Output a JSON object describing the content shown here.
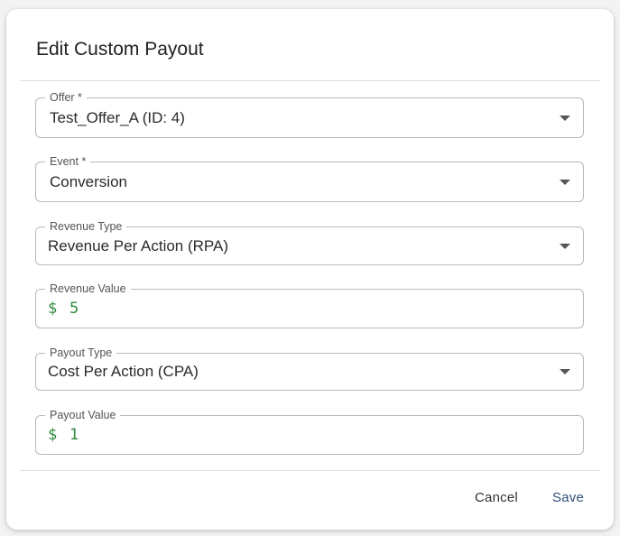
{
  "dialog": {
    "title": "Edit Custom Payout"
  },
  "fields": {
    "offer": {
      "label": "Offer *",
      "value": "Test_Offer_A (ID: 4)"
    },
    "event": {
      "label": "Event *",
      "value": "Conversion"
    },
    "revenue_type": {
      "label": "Revenue Type",
      "value": "Revenue Per Action (RPA)"
    },
    "revenue_value": {
      "label": "Revenue Value",
      "currency": "$",
      "value": "5"
    },
    "payout_type": {
      "label": "Payout Type",
      "value": "Cost Per Action (CPA)"
    },
    "payout_value": {
      "label": "Payout Value",
      "currency": "$",
      "value": "1"
    }
  },
  "actions": {
    "cancel_label": "Cancel",
    "save_label": "Save"
  },
  "colors": {
    "money_text": "#2e8b3e",
    "save_text": "#2f4f7a",
    "cancel_text": "#333333"
  }
}
